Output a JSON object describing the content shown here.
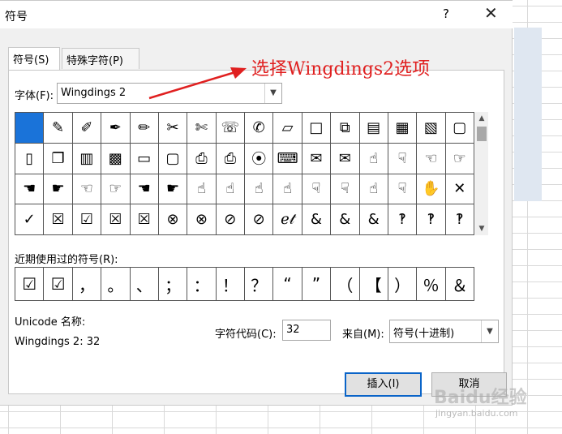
{
  "dialog": {
    "title": "符号",
    "help_label": "?",
    "close_label": "✕"
  },
  "tabs": [
    {
      "label": "符号(S)",
      "active": true
    },
    {
      "label": "特殊字符(P)",
      "active": false
    }
  ],
  "font": {
    "label": "字体(F):",
    "value": "Wingdings 2"
  },
  "annotation": {
    "text": "选择Wingdings2选项",
    "color": "#e02020"
  },
  "symbol_grid": {
    "rows": [
      [
        "",
        "✎",
        "✐",
        "✒",
        "✏",
        "✂",
        "✄",
        "☏",
        "✆",
        "▱",
        "□",
        "⧉",
        "▤",
        "▦",
        "▧",
        "▢"
      ],
      [
        "▯",
        "❐",
        "▥",
        "▩",
        "▭",
        "▢",
        "⎙",
        "⎙",
        "⦿",
        "⌨",
        "✉",
        "✉",
        "☝",
        "☟",
        "☜",
        "☞"
      ],
      [
        "☚",
        "☛",
        "☜",
        "☞",
        "☚",
        "☛",
        "☝",
        "☝",
        "☝",
        "☝",
        "☟",
        "☟",
        "☝",
        "☟",
        "✋",
        "✕"
      ],
      [
        "✓",
        "☒",
        "☑",
        "☒",
        "☒",
        "⊗",
        "⊗",
        "⊘",
        "⊘",
        "ℯ𝓉",
        "&",
        "&",
        "&",
        "‽",
        "‽",
        "‽"
      ]
    ],
    "selected_index": 0
  },
  "recent": {
    "label": "近期使用过的符号(R):",
    "symbols": [
      "☑",
      "☑",
      "，",
      "。",
      "、",
      "；",
      "：",
      "！",
      "？",
      "“",
      "”",
      "（",
      "【",
      "）",
      "％",
      "＆"
    ]
  },
  "unicode": {
    "name_label": "Unicode 名称:",
    "name_value": "Wingdings 2: 32"
  },
  "char_code": {
    "label": "字符代码(C):",
    "value": "32"
  },
  "from": {
    "label": "来自(M):",
    "value": "符号(十进制)"
  },
  "buttons": {
    "insert": "插入(I)",
    "cancel": "取消"
  },
  "watermark": {
    "brand": "Baidu经验",
    "url": "jingyan.baidu.com"
  },
  "colors": {
    "selected_cell": "#1a73d9",
    "accent_border": "#0a64c8"
  }
}
